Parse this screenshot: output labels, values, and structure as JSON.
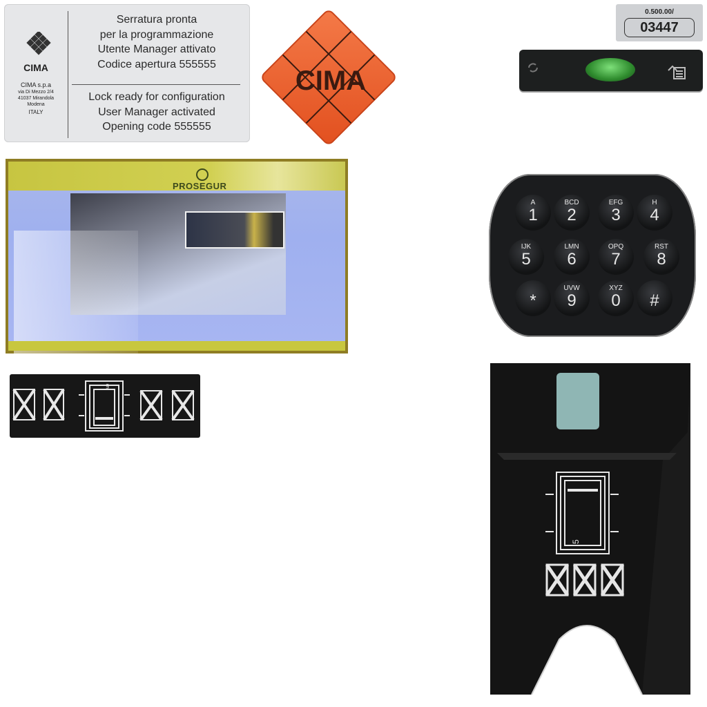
{
  "label_card": {
    "brand": "CIMA",
    "company": "CIMA s.p.a",
    "address_line1": "via Di Mezzo 2/4",
    "address_line2": "41037 Mirandola",
    "address_line3": "Modena",
    "country": "ITALY",
    "italian_lines": [
      "Serratura pronta",
      "per la programmazione",
      "Utente Manager attivato",
      "Codice apertura 555555"
    ],
    "english_lines": [
      "Lock ready for configuration",
      "User Manager activated",
      "Opening code 555555"
    ]
  },
  "badge": {
    "text": "CIMA"
  },
  "serial": {
    "prefix": "0.500.00/",
    "number": "03447"
  },
  "screen": {
    "brand": "PROSEGUR"
  },
  "keypad": {
    "keys": [
      {
        "sub": "A",
        "num": "1"
      },
      {
        "sub": "BCD",
        "num": "2"
      },
      {
        "sub": "EFG",
        "num": "3"
      },
      {
        "sub": "H",
        "num": "4"
      },
      {
        "sub": "IJK",
        "num": "5"
      },
      {
        "sub": "LMN",
        "num": "6"
      },
      {
        "sub": "OPQ",
        "num": "7"
      },
      {
        "sub": "RST",
        "num": "8"
      },
      {
        "sub": "",
        "num": "*"
      },
      {
        "sub": "UVW",
        "num": "9"
      },
      {
        "sub": "XYZ",
        "num": "0"
      },
      {
        "sub": "",
        "num": "#"
      }
    ]
  },
  "strip": {
    "digit": "5"
  },
  "validator": {
    "digit": "5"
  },
  "colors": {
    "badge": "#e8582a",
    "screen_bar": "#c8c73e",
    "led": "#3fae3c"
  }
}
